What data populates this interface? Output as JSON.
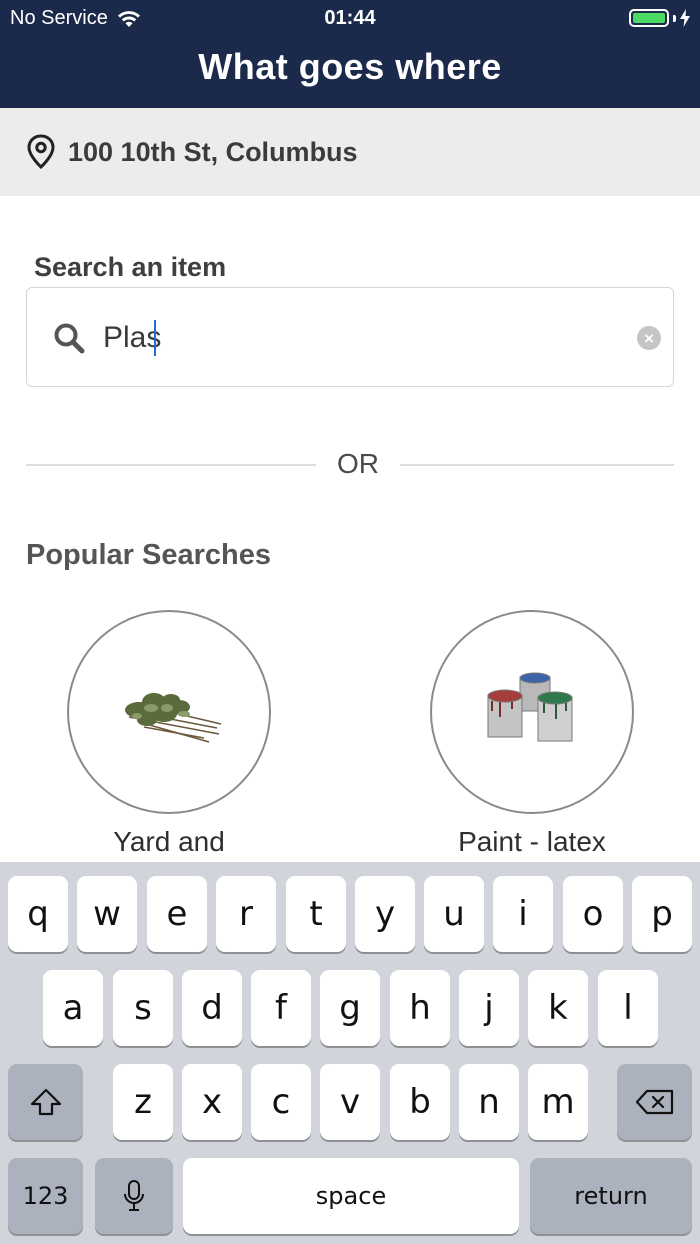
{
  "status_bar": {
    "carrier": "No Service",
    "time": "01:44",
    "battery_percent": 100
  },
  "nav": {
    "title": "What goes where"
  },
  "location": {
    "address": "100 10th St, Columbus",
    "icon": "map-pin-icon"
  },
  "search": {
    "label": "Search an item",
    "value": "Plas",
    "placeholder": "",
    "icon": "search-icon"
  },
  "divider": {
    "text": "OR"
  },
  "popular": {
    "title": "Popular Searches",
    "items": [
      {
        "label": "Yard and",
        "image": "yard-waste-image"
      },
      {
        "label": "Paint - latex",
        "image": "paint-cans-image"
      }
    ]
  },
  "keyboard": {
    "row1": [
      "q",
      "w",
      "e",
      "r",
      "t",
      "y",
      "u",
      "i",
      "o",
      "p"
    ],
    "row2": [
      "a",
      "s",
      "d",
      "f",
      "g",
      "h",
      "j",
      "k",
      "l"
    ],
    "row3": [
      "z",
      "x",
      "c",
      "v",
      "b",
      "n",
      "m"
    ],
    "numbers_label": "123",
    "space_label": "space",
    "return_label": "return"
  },
  "colors": {
    "header_bg": "#1b2a4a",
    "location_bg": "#ececec",
    "keyboard_bg": "#d1d4da",
    "battery": "#4cd964"
  }
}
